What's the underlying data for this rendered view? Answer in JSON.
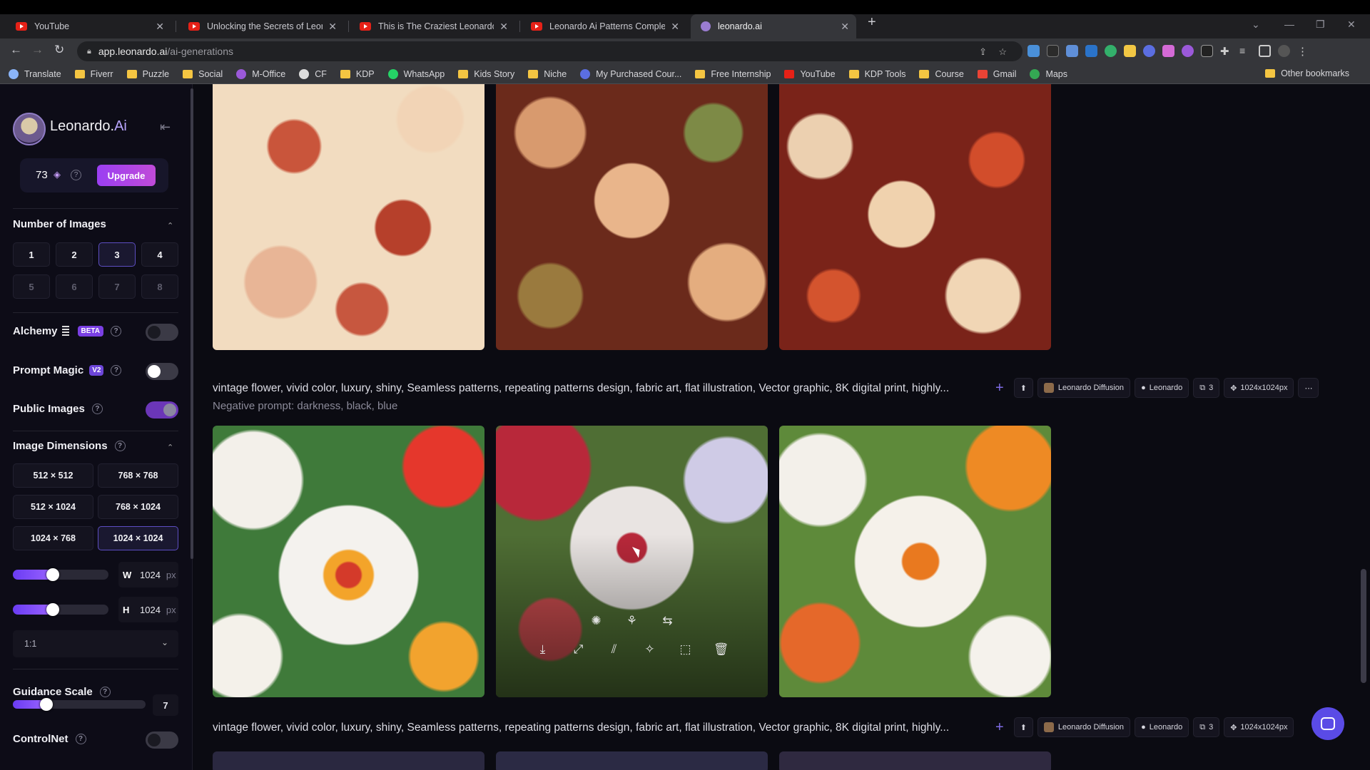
{
  "browser": {
    "tabs": [
      {
        "title": "YouTube",
        "icon": "youtube-icon"
      },
      {
        "title": "Unlocking the Secrets of Leonard",
        "icon": "youtube-icon"
      },
      {
        "title": "This is The Craziest Leonardo.Ai",
        "icon": "youtube-icon"
      },
      {
        "title": "Leonardo Ai Patterns Complete G",
        "icon": "youtube-icon"
      },
      {
        "title": "leonardo.ai",
        "icon": "leonardo-icon"
      }
    ],
    "url_host": "app.leonardo.ai",
    "url_path": "/ai-generations",
    "bookmarks": [
      "Translate",
      "Fiverr",
      "Puzzle",
      "Social",
      "M-Office",
      "CF",
      "KDP",
      "WhatsApp",
      "Kids Story",
      "Niche",
      "My Purchased Cour...",
      "Free Internship",
      "YouTube",
      "KDP Tools",
      "Course",
      "Gmail",
      "Maps"
    ],
    "other_bookmarks": "Other bookmarks"
  },
  "sidebar": {
    "brand_name": "Leonardo.",
    "brand_suffix": "Ai",
    "credits": "73",
    "upgrade_label": "Upgrade",
    "number_of_images": {
      "title": "Number of Images",
      "options": [
        "1",
        "2",
        "3",
        "4",
        "5",
        "6",
        "7",
        "8"
      ],
      "selected": "3"
    },
    "alchemy": {
      "label": "Alchemy",
      "badge": "BETA",
      "enabled": false
    },
    "prompt_magic": {
      "label": "Prompt Magic",
      "badge": "V2",
      "enabled": false
    },
    "public_images": {
      "label": "Public Images",
      "enabled": true
    },
    "image_dimensions": {
      "title": "Image Dimensions",
      "options": [
        "512 × 512",
        "768 × 768",
        "512 × 1024",
        "768 × 1024",
        "1024 × 768",
        "1024 × 1024"
      ],
      "selected": "1024 × 1024",
      "width_label": "W",
      "width": "1024",
      "height_label": "H",
      "height": "1024",
      "unit": "px",
      "width_slider": 0.42,
      "height_slider": 0.42,
      "aspect_ratio": "1:1"
    },
    "guidance_scale": {
      "label": "Guidance Scale",
      "value": "7",
      "slider": 0.25
    },
    "controlnet": {
      "label": "ControlNet",
      "enabled": false
    }
  },
  "generations": [
    {
      "prompt": "vintage flower, vivid color, luxury, shiny, Seamless patterns, repeating patterns design, fabric art, flat illustration, Vector graphic, 8K digital print, highly...",
      "negative_prompt": "Negative prompt: darkness, black, blue",
      "model": "Leonardo Diffusion",
      "preset": "Leonardo",
      "count": "3",
      "size": "1024x1024px"
    },
    {
      "prompt": "vintage flower, vivid color, luxury, shiny, Seamless patterns, repeating patterns design, fabric art, flat illustration, Vector graphic, 8K digital print, highly...",
      "model": "Leonardo Diffusion",
      "preset": "Leonardo",
      "count": "3",
      "size": "1024x1024px"
    }
  ],
  "colors": {
    "accent": "#6a3cf3",
    "upgrade_gradient_start": "#9b3ff2",
    "sidebar_bg": "#0d0c17",
    "main_bg": "#0b0b12"
  }
}
